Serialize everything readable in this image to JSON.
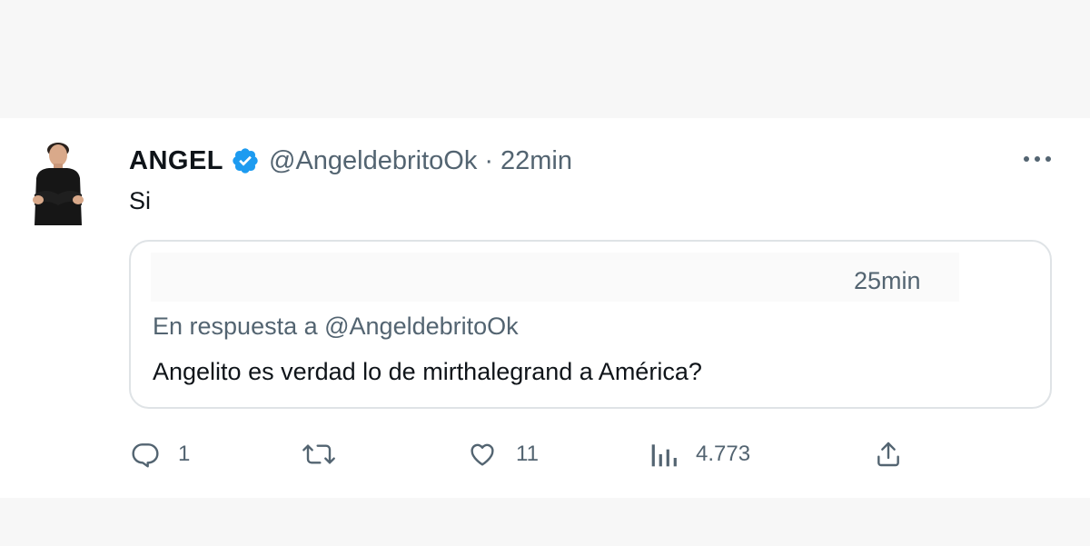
{
  "tweet": {
    "author": {
      "name": "ANGEL",
      "handle": "@AngeldebritoOk",
      "separator": "·",
      "time": "22min",
      "verified_icon": "verified-badge-icon",
      "verified_color": "#1d9bf0"
    },
    "text": "Si",
    "more_icon": "more-dots-icon",
    "quoted": {
      "time": "25min",
      "reply_to": "En respuesta a @AngeldebritoOk",
      "text": "Angelito es verdad lo de mirthalegrand a América?"
    },
    "actions": {
      "reply": {
        "icon": "reply-icon",
        "count": "1"
      },
      "retweet": {
        "icon": "retweet-icon"
      },
      "like": {
        "icon": "heart-icon",
        "count": "11"
      },
      "views": {
        "icon": "views-chart-icon",
        "count": "4.773"
      },
      "share": {
        "icon": "share-icon"
      }
    }
  },
  "colors": {
    "text_primary": "#0f1419",
    "text_secondary": "#536471",
    "border": "#dfe3e6",
    "background": "#ffffff"
  }
}
